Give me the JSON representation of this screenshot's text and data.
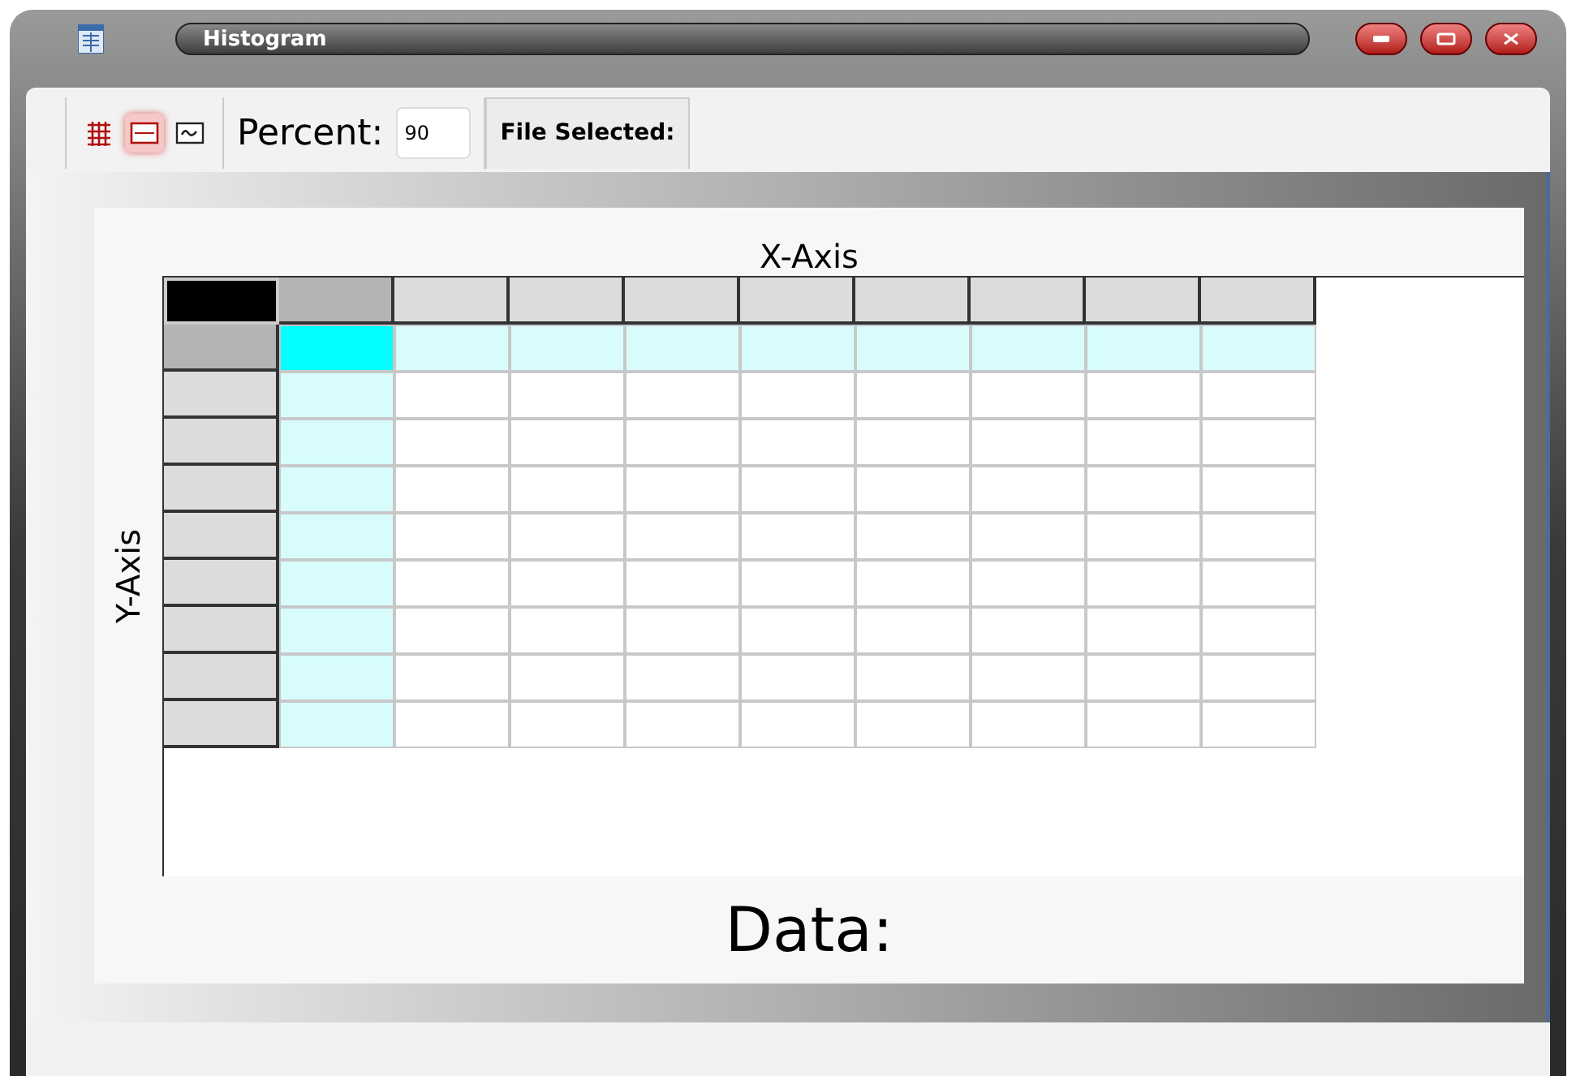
{
  "window": {
    "title": "Histogram"
  },
  "toolbar": {
    "view_buttons": [
      {
        "kind": "grid",
        "selected": false
      },
      {
        "kind": "table",
        "selected": true
      },
      {
        "kind": "chart",
        "selected": false
      }
    ],
    "percent_label": "Percent:",
    "percent_value": "90",
    "file_label": "File Selected:"
  },
  "table": {
    "x_axis_label": "X-Axis",
    "y_axis_label": "Y-Axis",
    "columns": [
      {
        "selected": true
      },
      {
        "selected": false
      },
      {
        "selected": false
      },
      {
        "selected": false
      },
      {
        "selected": false
      },
      {
        "selected": false
      },
      {
        "selected": false
      },
      {
        "selected": false
      },
      {
        "selected": false
      }
    ],
    "rows": [
      {
        "selected": true
      },
      {
        "selected": false
      },
      {
        "selected": false
      },
      {
        "selected": false
      },
      {
        "selected": false
      },
      {
        "selected": false
      },
      {
        "selected": false
      },
      {
        "selected": false
      },
      {
        "selected": false
      }
    ]
  },
  "data_label": "Data:"
}
